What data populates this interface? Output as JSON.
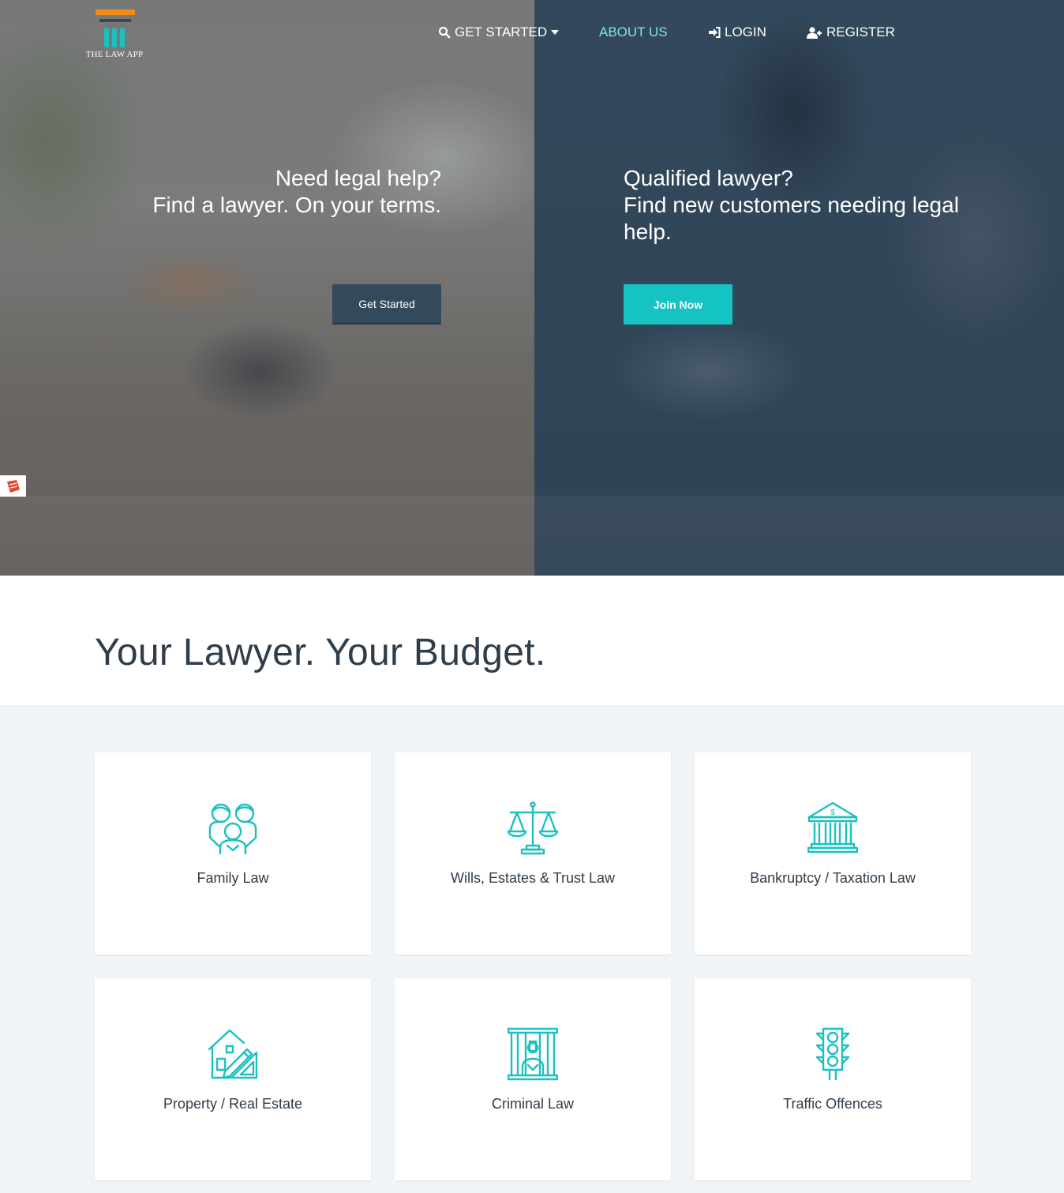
{
  "brand": {
    "name": "THE LAW APP"
  },
  "nav": {
    "items": [
      {
        "label": "GET STARTED",
        "icon": "search-icon",
        "has_dropdown": true
      },
      {
        "label": "ABOUT US",
        "active": true
      },
      {
        "label": "LOGIN",
        "icon": "sign-in-icon"
      },
      {
        "label": "REGISTER",
        "icon": "user-plus-icon"
      }
    ]
  },
  "hero": {
    "left": {
      "line1": "Need legal help?",
      "line2": "Find a lawyer. On your terms.",
      "button": "Get Started"
    },
    "right": {
      "line1": "Qualified lawyer?",
      "line2": "Find new customers needing legal help.",
      "button": "Join Now"
    }
  },
  "tagline": "Your Lawyer. Your Budget.",
  "categories": [
    {
      "label": "Family Law",
      "icon": "family-icon"
    },
    {
      "label": "Wills, Estates & Trust Law",
      "icon": "scales-icon"
    },
    {
      "label": "Bankruptcy / Taxation Law",
      "icon": "bank-icon"
    },
    {
      "label": "Property / Real Estate",
      "icon": "house-plan-icon"
    },
    {
      "label": "Criminal Law",
      "icon": "prison-icon"
    },
    {
      "label": "Traffic Offences",
      "icon": "traffic-light-icon"
    }
  ],
  "colors": {
    "accent": "#1cc0c0",
    "dark_button": "#35495d",
    "logo_orange": "#f28a1a",
    "nav_active": "#7fe6e0"
  }
}
